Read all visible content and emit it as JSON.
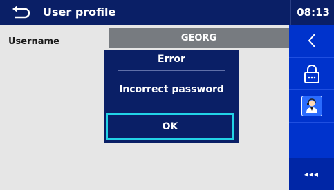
{
  "header": {
    "title": "User profile",
    "time": "08:13"
  },
  "form": {
    "username_label": "Username",
    "username_value": "GEORG"
  },
  "dialog": {
    "title": "Error",
    "message": "Incorrect password",
    "ok_label": "OK"
  },
  "sidebar": {
    "more_label": "◂◂◂"
  },
  "colors": {
    "header_bg": "#0a1f66",
    "sidebar_bg": "#0033cc",
    "dialog_bg": "#0a1f66",
    "focus_border": "#22d3e6",
    "content_bg": "#e6e6e6"
  },
  "icons": [
    "back-icon",
    "chevron-left-icon",
    "lock-icon",
    "operator-icon"
  ]
}
